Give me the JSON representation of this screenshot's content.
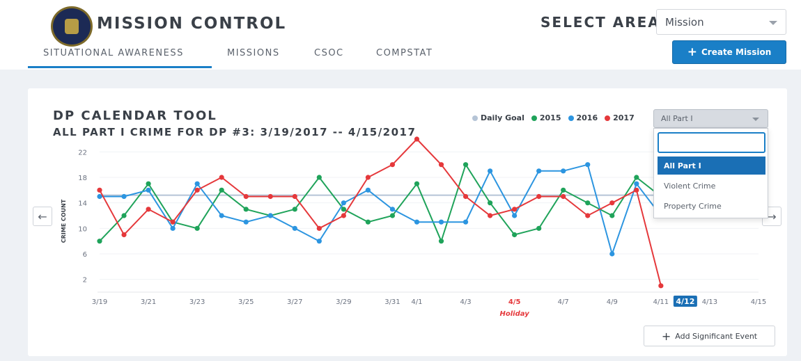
{
  "header": {
    "app_title": "MISSION CONTROL",
    "select_area_label": "SELECT AREA",
    "area_select_value": "Mission",
    "create_mission_label": "Create Mission"
  },
  "nav": {
    "tabs": [
      {
        "label": "SITUATIONAL AWARENESS",
        "active": true
      },
      {
        "label": "MISSIONS",
        "active": false
      },
      {
        "label": "CSOC",
        "active": false
      },
      {
        "label": "COMPSTAT",
        "active": false
      }
    ]
  },
  "panel": {
    "title": "DP CALENDAR TOOL",
    "subtitle": "ALL PART I CRIME FOR DP #3: 3/19/2017 -- 4/15/2017",
    "crime_select_value": "All Part I",
    "dropdown_options": [
      "All Part I",
      "Violent Crime",
      "Property Crime"
    ],
    "dropdown_search_placeholder": "",
    "prev_icon": "arrow-left-icon",
    "next_icon": "arrow-right-icon",
    "add_event_label": "Add Significant Event"
  },
  "colors": {
    "daily_goal": "#b5c4d6",
    "s2015": "#1fa35a",
    "s2016": "#2c95e0",
    "s2017": "#e5383b",
    "accent": "#1a7fc7",
    "holiday": "#e5383b"
  },
  "chart_data": {
    "type": "line",
    "ylabel": "CRIME COUNT",
    "xlabel": "",
    "y_ticks": [
      2,
      6,
      10,
      14,
      18,
      22
    ],
    "x_tick_labels": [
      "3/19",
      "3/21",
      "3/23",
      "3/25",
      "3/27",
      "3/29",
      "3/31",
      "4/1",
      "4/3",
      "4/5",
      "4/7",
      "4/9",
      "4/11",
      "4/12",
      "4/13",
      "4/15"
    ],
    "x_tick_day_index": [
      0,
      2,
      4,
      6,
      8,
      10,
      12,
      13,
      15,
      17,
      19,
      21,
      23,
      24,
      25,
      27
    ],
    "highlighted_tick": "4/12",
    "holiday_tick": "4/5",
    "holiday_label": "Holiday",
    "xlim": [
      0,
      27
    ],
    "ylim": [
      0,
      24
    ],
    "legend": [
      "Daily Goal",
      "2015",
      "2016",
      "2017"
    ],
    "daily_goal": 15.2,
    "series": [
      {
        "name": "2015",
        "values": [
          8,
          12,
          17,
          11,
          10,
          16,
          13,
          12,
          13,
          18,
          13,
          11,
          12,
          17,
          8,
          20,
          14,
          9,
          10,
          16,
          14,
          12,
          18,
          15
        ]
      },
      {
        "name": "2016",
        "values": [
          15,
          15,
          16,
          10,
          17,
          12,
          11,
          12,
          10,
          8,
          14,
          16,
          13,
          11,
          11,
          11,
          19,
          12,
          19,
          19,
          20,
          6,
          17,
          12
        ]
      },
      {
        "name": "2017",
        "values": [
          16,
          9,
          13,
          11,
          16,
          18,
          15,
          15,
          15,
          10,
          12,
          18,
          20,
          24,
          20,
          15,
          12,
          13,
          15,
          15,
          12,
          14,
          16,
          1
        ]
      }
    ]
  }
}
